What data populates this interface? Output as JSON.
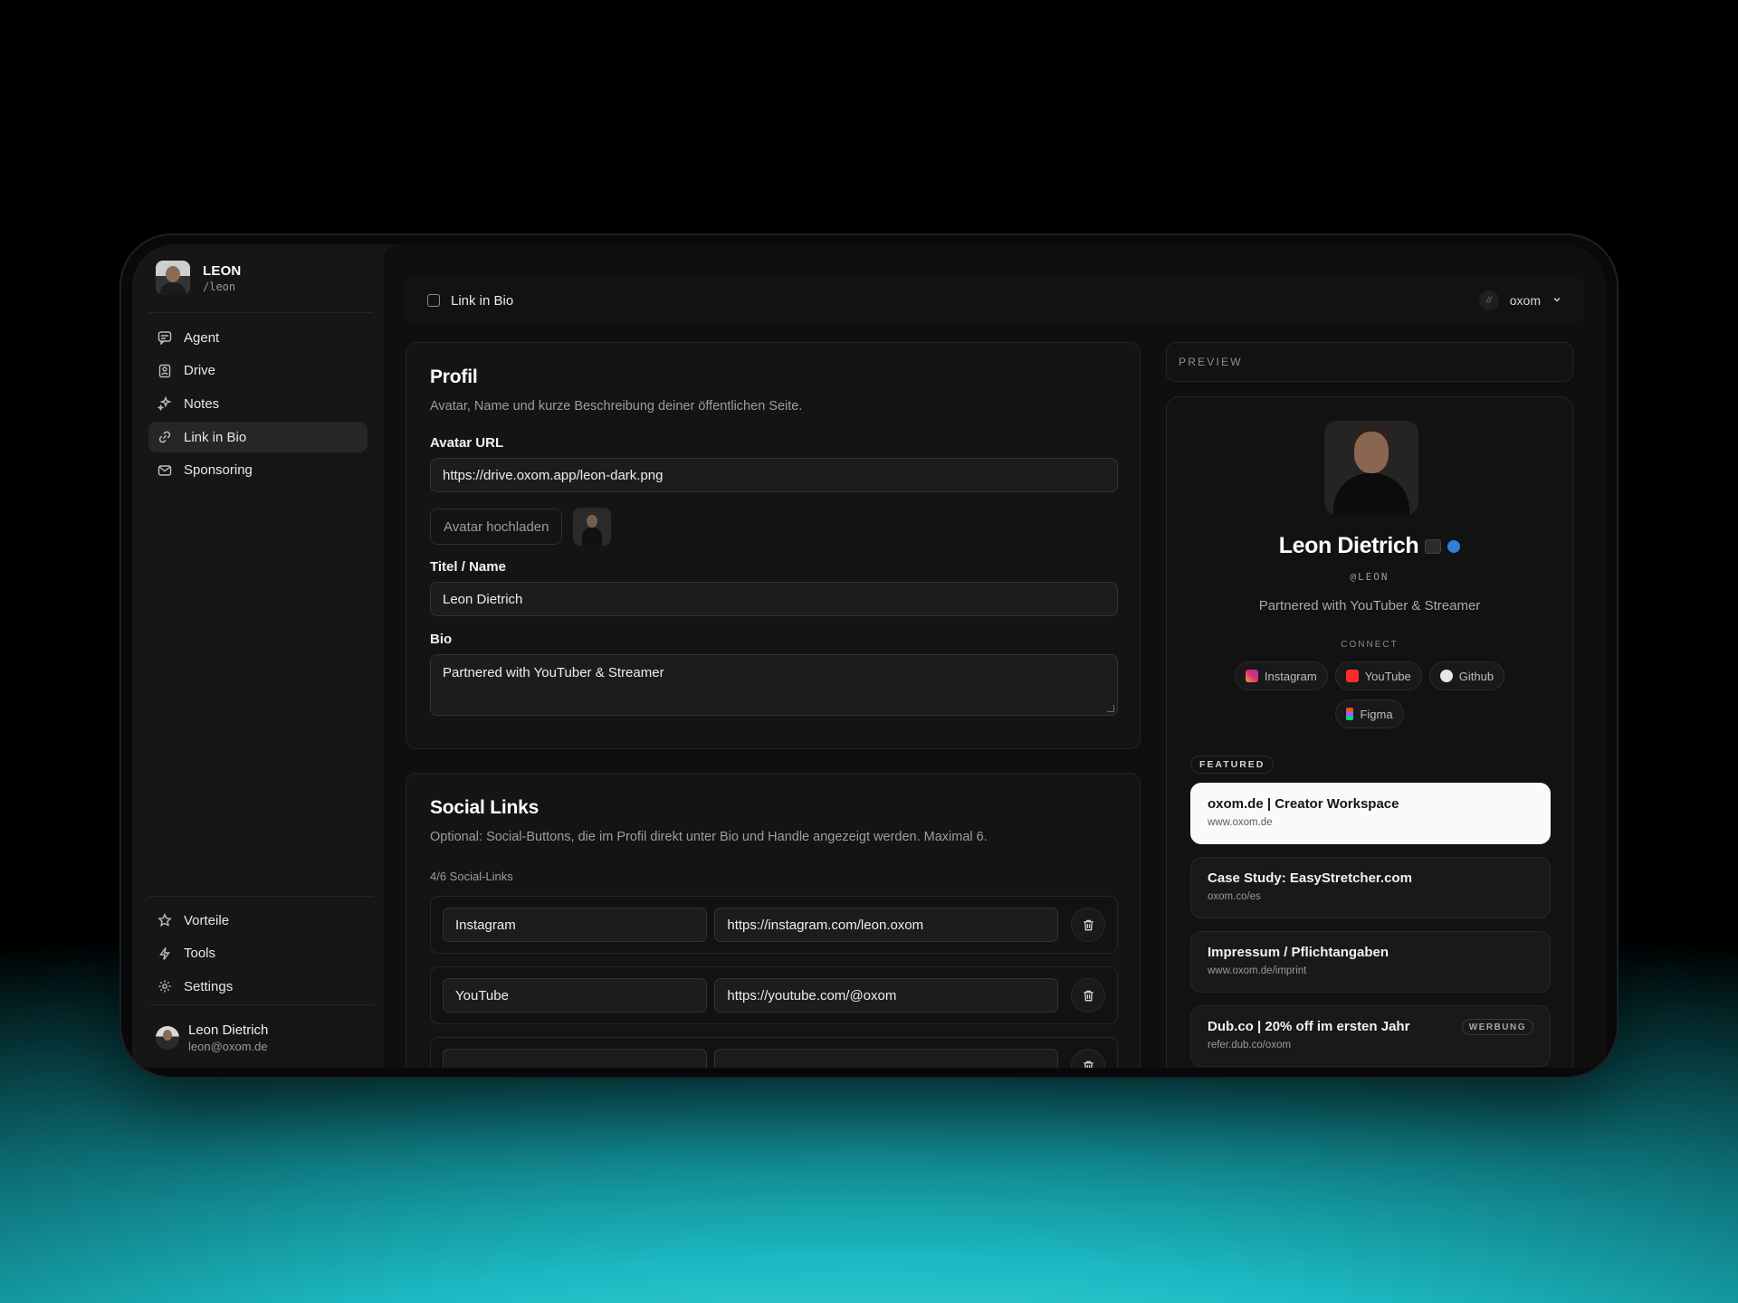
{
  "sidebar": {
    "brand": {
      "name": "LEON",
      "handle": "/leon"
    },
    "nav": [
      {
        "label": "Agent",
        "icon": "chat-icon"
      },
      {
        "label": "Drive",
        "icon": "drive-icon"
      },
      {
        "label": "Notes",
        "icon": "sparkle-icon"
      },
      {
        "label": "Link in Bio",
        "icon": "link-icon",
        "active": true
      },
      {
        "label": "Sponsoring",
        "icon": "mail-icon"
      }
    ],
    "footer_nav": [
      {
        "label": "Vorteile",
        "icon": "star-icon"
      },
      {
        "label": "Tools",
        "icon": "bolt-icon"
      },
      {
        "label": "Settings",
        "icon": "gear-icon"
      }
    ],
    "user": {
      "name": "Leon Dietrich",
      "email": "leon@oxom.de"
    }
  },
  "topbar": {
    "title": "Link in Bio",
    "workspace": "oxom",
    "workspace_badge": "//"
  },
  "profil": {
    "title": "Profil",
    "description": "Avatar, Name und kurze Beschreibung deiner öffentlichen Seite.",
    "avatar_label": "Avatar URL",
    "avatar_value": "https://drive.oxom.app/leon-dark.png",
    "upload_label": "Avatar hochladen",
    "name_label": "Titel / Name",
    "name_value": "Leon Dietrich",
    "bio_label": "Bio",
    "bio_value": "Partnered with YouTuber & Streamer"
  },
  "social": {
    "title": "Social Links",
    "description": "Optional: Social-Buttons, die im Profil direkt unter Bio und Handle angezeigt werden. Maximal 6.",
    "count": "4/6 Social-Links",
    "rows": [
      {
        "platform": "Instagram",
        "url": "https://instagram.com/leon.oxom"
      },
      {
        "platform": "YouTube",
        "url": "https://youtube.com/@oxom"
      },
      {
        "platform": "",
        "url": ""
      }
    ]
  },
  "preview": {
    "header": "PREVIEW",
    "name": "Leon Dietrich",
    "handle": "@LEON",
    "bio": "Partnered with YouTuber & Streamer",
    "connect_label": "CONNECT",
    "chips": [
      {
        "label": "Instagram",
        "icon": "instagram-icon"
      },
      {
        "label": "YouTube",
        "icon": "youtube-icon"
      },
      {
        "label": "Github",
        "icon": "github-icon"
      },
      {
        "label": "Figma",
        "icon": "figma-icon"
      }
    ],
    "featured_label": "FEATURED",
    "links": [
      {
        "title": "oxom.de | Creator Workspace",
        "url": "www.oxom.de"
      },
      {
        "title": "Case Study: EasyStretcher.com",
        "url": "oxom.co/es"
      },
      {
        "title": "Impressum / Pflichtangaben",
        "url": "www.oxom.de/imprint"
      },
      {
        "title": "Dub.co | 20% off im ersten Jahr",
        "url": "refer.dub.co/oxom",
        "badge": "WERBUNG"
      }
    ]
  },
  "colors": {
    "accent": "#2f7fd6",
    "background_glow": "#1cb9c2",
    "panel": "#141414"
  }
}
